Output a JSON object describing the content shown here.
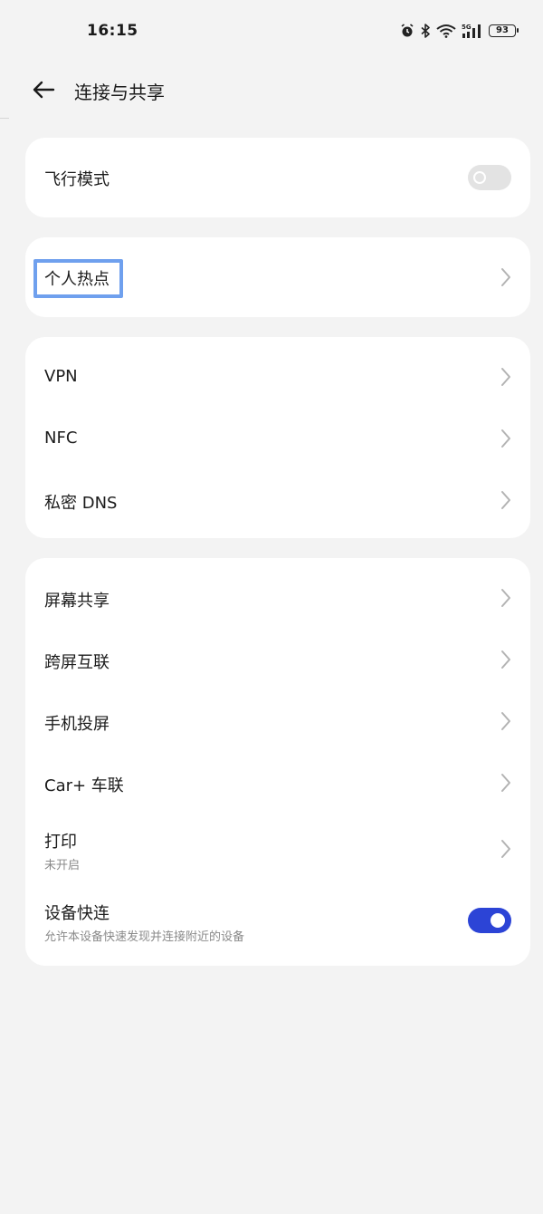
{
  "status_bar": {
    "time": "16:15",
    "battery": "93",
    "icons": [
      "alarm-icon",
      "bluetooth-icon",
      "wifi-icon",
      "5g-signal-icon",
      "battery-icon"
    ]
  },
  "header": {
    "title": "连接与共享",
    "back_icon": "arrow-left-icon"
  },
  "airplane": {
    "label": "飞行模式",
    "enabled": false
  },
  "hotspot": {
    "label": "个人热点"
  },
  "network": {
    "vpn": "VPN",
    "nfc": "NFC",
    "private_dns": "私密 DNS"
  },
  "sharing": {
    "screen_share": "屏幕共享",
    "cross_screen": "跨屏互联",
    "cast": "手机投屏",
    "car": "Car+ 车联",
    "print": {
      "label": "打印",
      "sub": "未开启"
    },
    "quick_connect": {
      "label": "设备快连",
      "sub": "允许本设备快速发现并连接附近的设备",
      "enabled": true
    }
  },
  "colors": {
    "accent": "#2c44d6",
    "focus": "#6fa0ee",
    "background": "#f3f3f3"
  }
}
